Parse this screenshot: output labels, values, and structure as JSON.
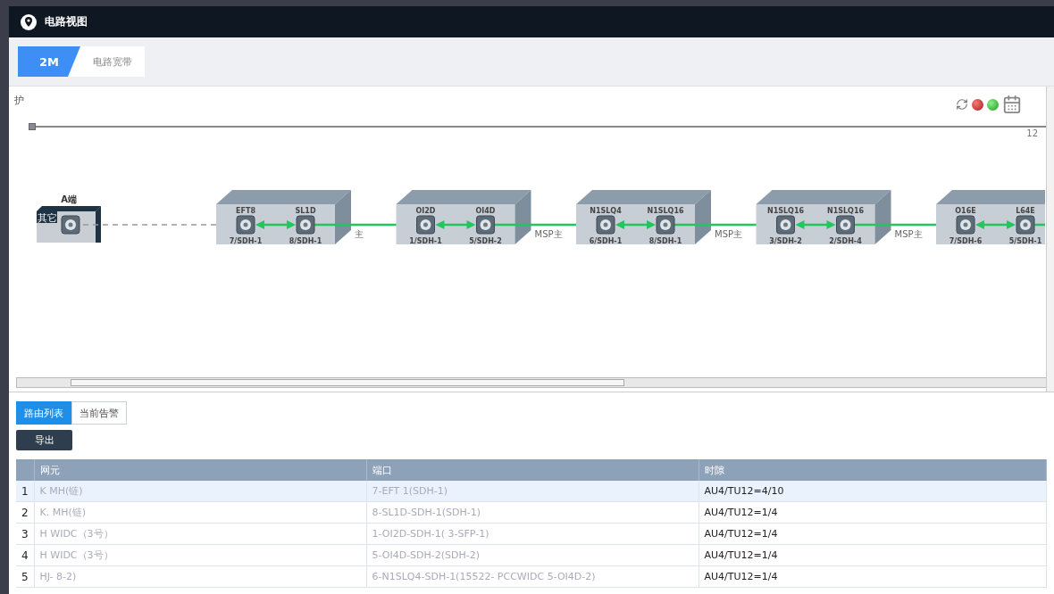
{
  "window": {
    "title": "电路视图"
  },
  "tabs": [
    {
      "label": "2M",
      "selected": true
    },
    {
      "label": "电路宽带",
      "selected": false
    }
  ],
  "topology": {
    "corner_label": "护",
    "timeline": {
      "level": 0
    },
    "edge_label": "12",
    "a_end": {
      "label": "A端",
      "tag": "其它"
    },
    "devices": [
      {
        "ports": [
          {
            "card": "EFT8",
            "port": "7/SDH-1"
          },
          {
            "card": "SL1D",
            "port": "8/SDH-1"
          }
        ],
        "link_label": "主"
      },
      {
        "ports": [
          {
            "card": "OI2D",
            "port": "1/SDH-1"
          },
          {
            "card": "OI4D",
            "port": "5/SDH-2"
          }
        ],
        "link_label": "MSP主"
      },
      {
        "ports": [
          {
            "card": "N1SLQ4",
            "port": "6/SDH-1"
          },
          {
            "card": "N1SLQ16",
            "port": "8/SDH-1"
          }
        ],
        "link_label": "MSP主"
      },
      {
        "ports": [
          {
            "card": "N1SLQ16",
            "port": "3/SDH-2"
          },
          {
            "card": "N1SLQ16",
            "port": "2/SDH-4"
          }
        ],
        "link_label": "MSP主"
      },
      {
        "ports": [
          {
            "card": "O16E",
            "port": "7/SDH-6"
          },
          {
            "card": "L64E",
            "port": "5/SDH-1"
          }
        ]
      }
    ]
  },
  "subtabs": [
    {
      "label": "路由列表",
      "selected": true
    },
    {
      "label": "当前告警",
      "selected": false
    }
  ],
  "export_button": "导出",
  "table": {
    "columns": [
      "网元",
      "端口",
      "时隙"
    ],
    "rows": [
      {
        "index": "1",
        "cells": [
          "K      MH(链)",
          "7-EFT      1(SDH-1)",
          "AU4/TU12=4/10"
        ],
        "selected": true
      },
      {
        "index": "2",
        "cells": [
          "K.      MH(链)",
          "8-SL1D-SDH-1(SDH-1)",
          "AU4/TU12=1/4"
        ],
        "selected": false
      },
      {
        "index": "3",
        "cells": [
          "H      WIDC（3号）",
          "1-OI2D-SDH-1(      3-SFP-1)",
          "AU4/TU12=1/4"
        ],
        "selected": false
      },
      {
        "index": "4",
        "cells": [
          "H      WIDC（3号）",
          "5-OI4D-SDH-2(SDH-2)",
          "AU4/TU12=1/4"
        ],
        "selected": false
      },
      {
        "index": "5",
        "cells": [
          "HJ-      8-2)",
          "6-N1SLQ4-SDH-1(15522-      PCCWIDC 5-OI4D-2)",
          "AU4/TU12=1/4"
        ],
        "selected": false
      }
    ]
  }
}
